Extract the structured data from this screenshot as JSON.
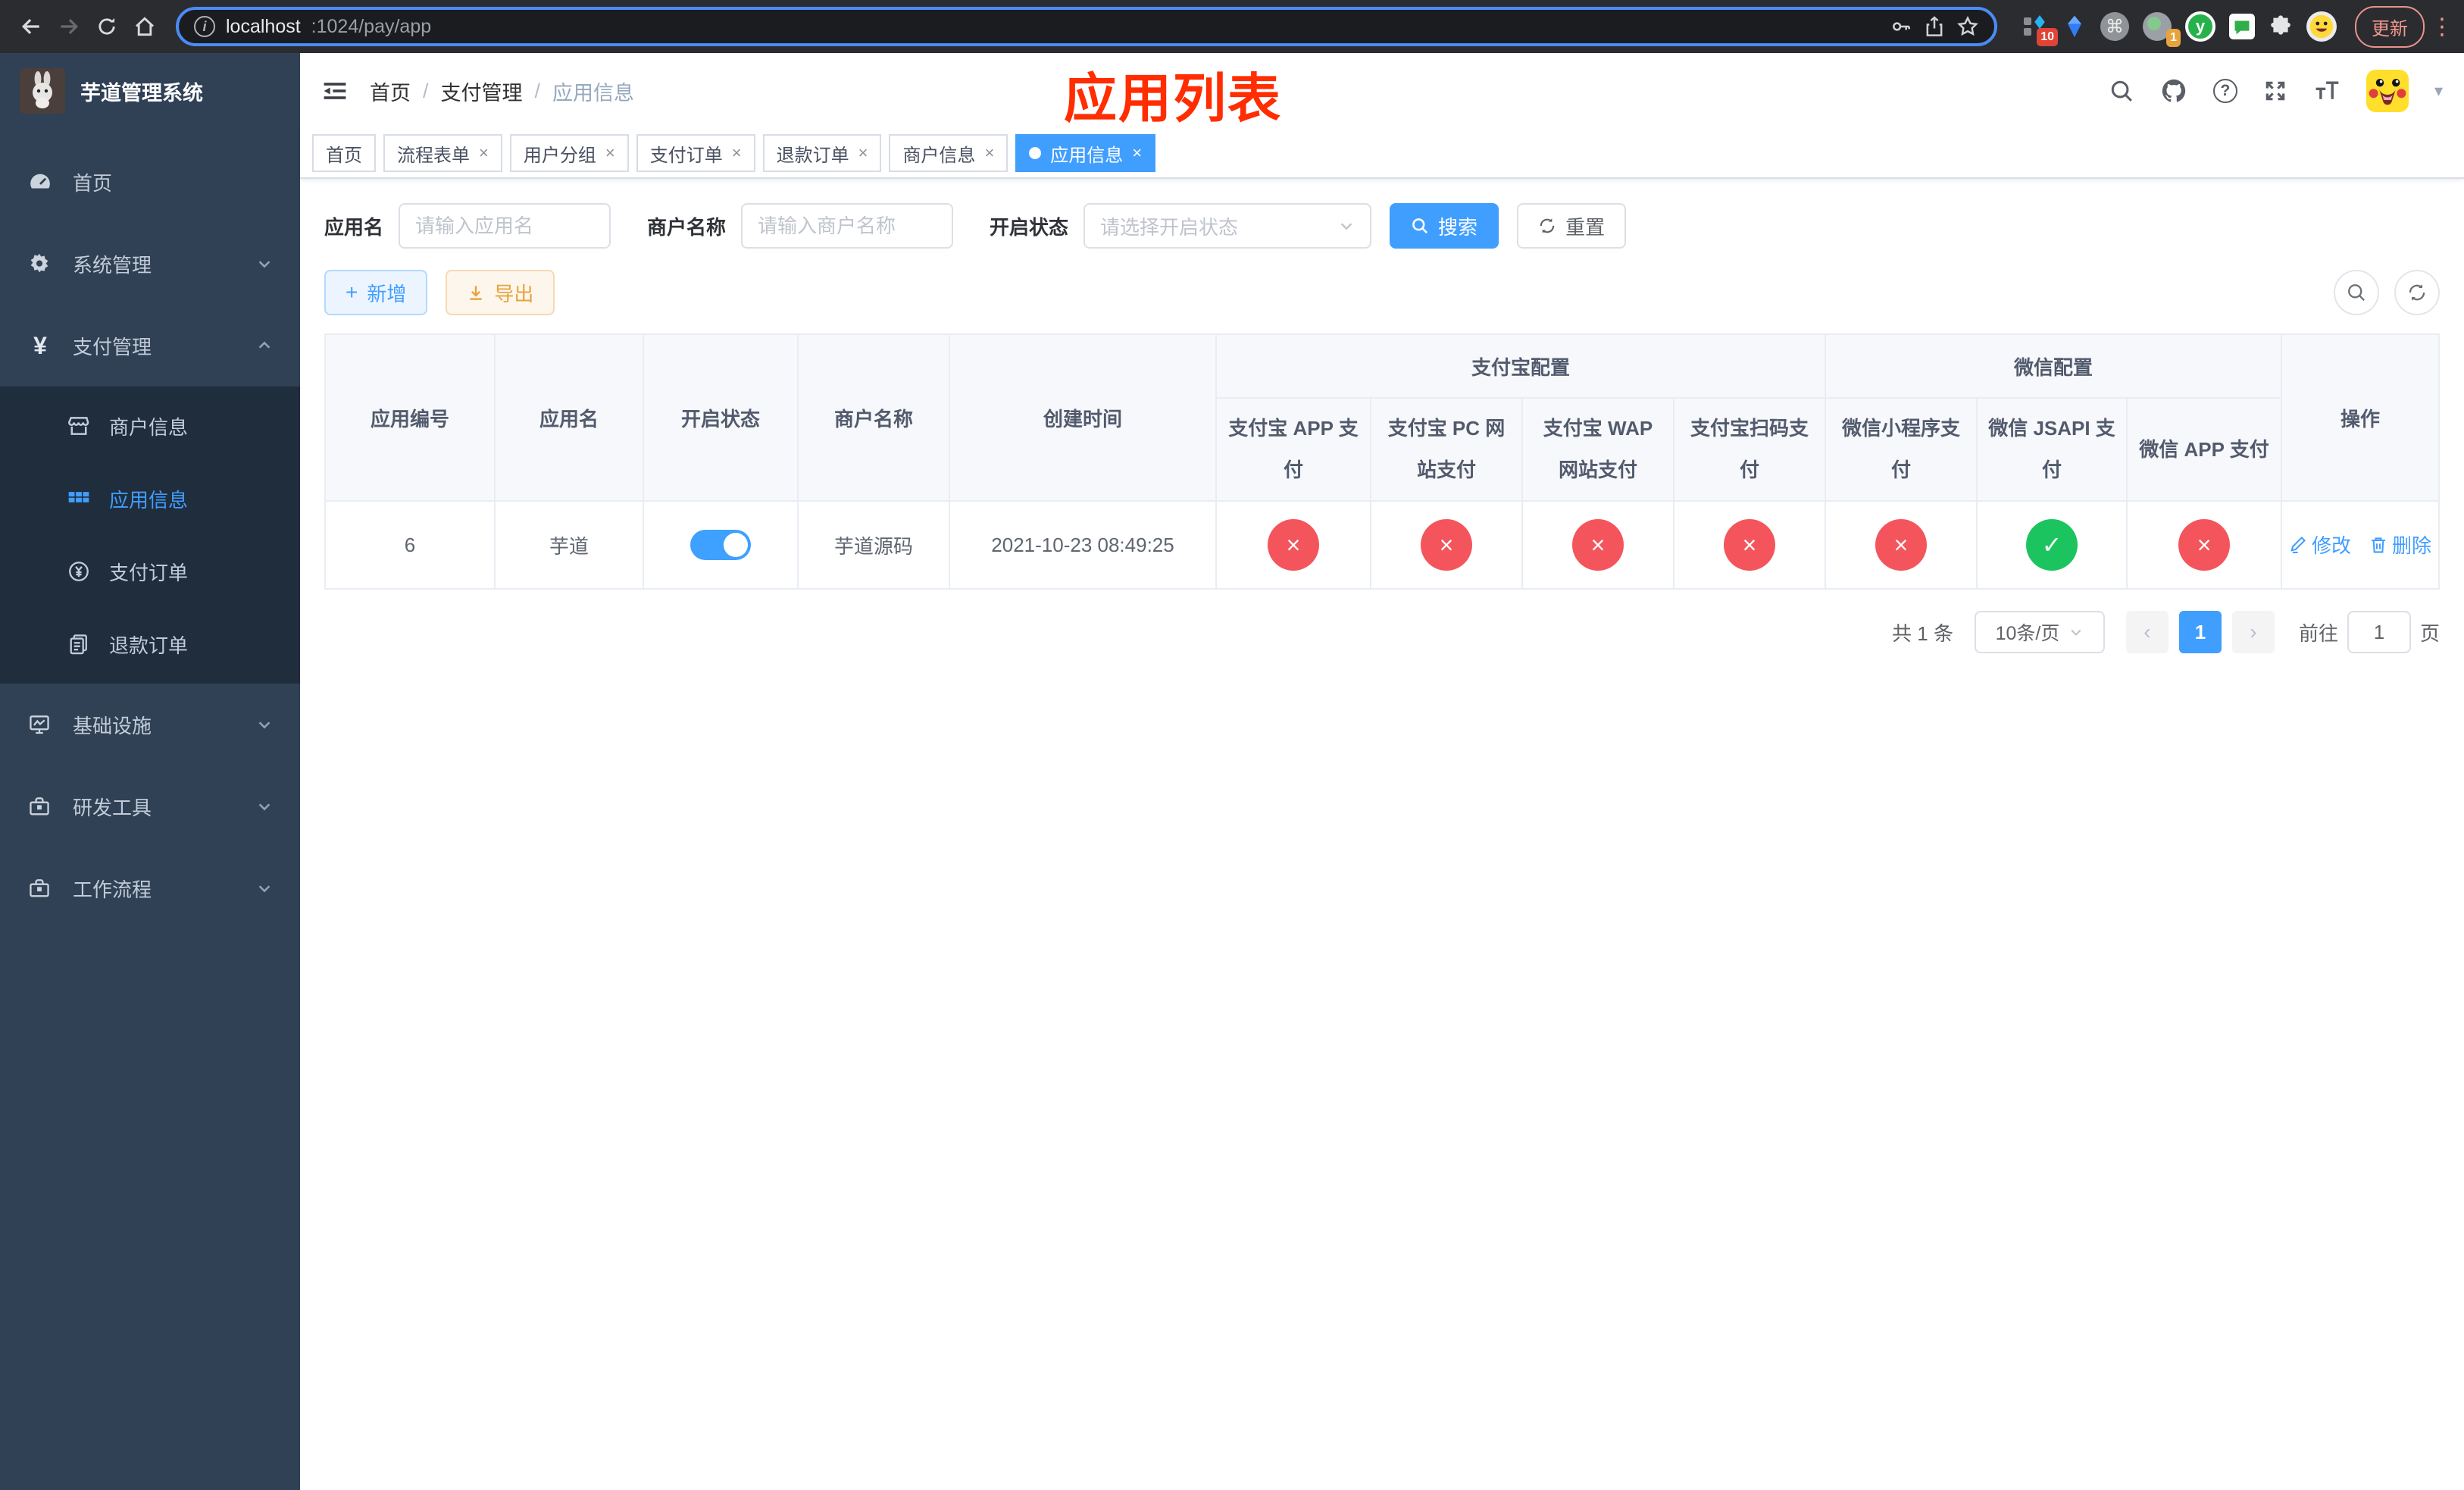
{
  "colors": {
    "accent": "#409eff",
    "success": "#1cc45f",
    "danger": "#f4555c",
    "warning": "#e6a23c",
    "annotation": "#ff2d00",
    "sidebar_bg": "#304156",
    "submenu_bg": "#1f2d3d"
  },
  "icons": {
    "close": "×",
    "cross": "×",
    "check": "✓",
    "question": "?",
    "info": "i",
    "command": "⌘",
    "dots": "⋮",
    "prev": "‹",
    "next": "›",
    "yen": "¥",
    "plus": "+",
    "letter_y": "y",
    "caret_down": "▾"
  },
  "browser": {
    "url_host": "localhost",
    "url_path": ":1024/pay/app",
    "update_label": "更新",
    "ext_badges": {
      "pinned": "10",
      "timer": "1"
    }
  },
  "sidebar": {
    "logo_title": "芋道管理系统",
    "items": [
      {
        "label": "首页"
      },
      {
        "label": "系统管理"
      },
      {
        "label": "支付管理",
        "children": [
          {
            "label": "商户信息"
          },
          {
            "label": "应用信息",
            "active": true
          },
          {
            "label": "支付订单"
          },
          {
            "label": "退款订单"
          }
        ]
      },
      {
        "label": "基础设施"
      },
      {
        "label": "研发工具"
      },
      {
        "label": "工作流程"
      }
    ]
  },
  "header": {
    "breadcrumb": [
      "首页",
      "支付管理",
      "应用信息"
    ],
    "separator": "/",
    "annotation": "应用列表"
  },
  "tabs": [
    {
      "label": "首页",
      "closable": false
    },
    {
      "label": "流程表单",
      "closable": true
    },
    {
      "label": "用户分组",
      "closable": true
    },
    {
      "label": "支付订单",
      "closable": true
    },
    {
      "label": "退款订单",
      "closable": true
    },
    {
      "label": "商户信息",
      "closable": true
    },
    {
      "label": "应用信息",
      "closable": true,
      "active": true
    }
  ],
  "filters": {
    "app_name_label": "应用名",
    "app_name_placeholder": "请输入应用名",
    "merchant_label": "商户名称",
    "merchant_placeholder": "请输入商户名称",
    "status_label": "开启状态",
    "status_placeholder": "请选择开启状态",
    "search_label": "搜索",
    "reset_label": "重置"
  },
  "toolbar": {
    "add_label": "新增",
    "export_label": "导出"
  },
  "table": {
    "columns": [
      "应用编号",
      "应用名",
      "开启状态",
      "商户名称",
      "创建时间"
    ],
    "groups": [
      "支付宝配置",
      "微信配置"
    ],
    "alipay_columns": [
      "支付宝 APP 支付",
      "支付宝 PC 网站支付",
      "支付宝 WAP 网站支付",
      "支付宝扫码支付"
    ],
    "wechat_columns": [
      "微信小程序支付",
      "微信 JSAPI 支付",
      "微信 APP 支付"
    ],
    "action_column": "操作",
    "row": {
      "id": "6",
      "name": "芋道",
      "enabled": true,
      "merchant": "芋道源码",
      "created": "2021-10-23 08:49:25",
      "channel_enabled": [
        false,
        false,
        false,
        false,
        false,
        true,
        false
      ],
      "edit_label": "修改",
      "delete_label": "删除"
    }
  },
  "pagination": {
    "total": "共 1 条",
    "page_size": "10条/页",
    "page": "1",
    "goto_label": "前往",
    "goto_value": "1",
    "page_unit": "页"
  }
}
